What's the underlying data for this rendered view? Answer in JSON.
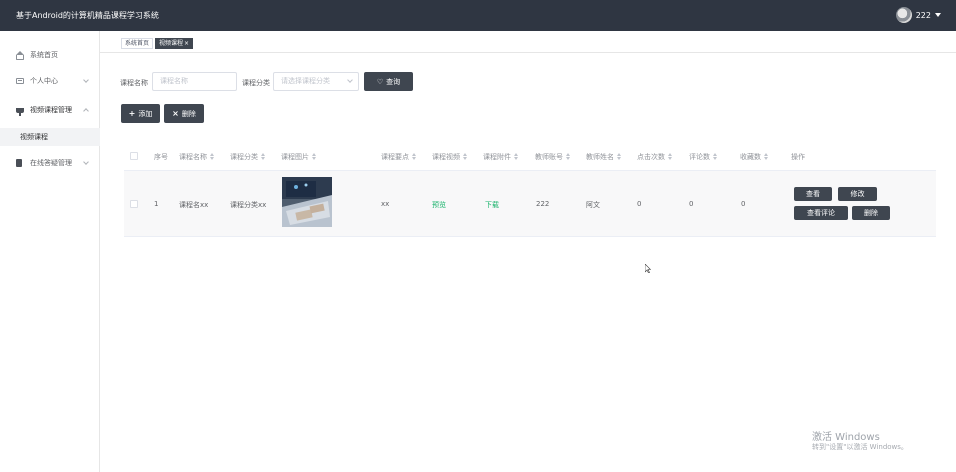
{
  "app": {
    "title": "基于Android的计算机精品课程学习系统"
  },
  "user": {
    "name": "222"
  },
  "sidebar": {
    "items": [
      {
        "label": "系统首页"
      },
      {
        "label": "个人中心"
      },
      {
        "label": "视频课程管理"
      },
      {
        "label": "在线答疑管理"
      }
    ],
    "sub_items": [
      {
        "label": "视频课程"
      }
    ]
  },
  "tabs": [
    {
      "label": "系统首页"
    },
    {
      "label": "视频课程",
      "close": "×"
    }
  ],
  "filters": {
    "course_name_label": "课程名称",
    "course_name_placeholder": "课程名称",
    "category_label": "课程分类",
    "category_placeholder": "请选择课程分类",
    "search_label": "查询"
  },
  "toolbar": {
    "add_label": "添加",
    "delete_label": "删除"
  },
  "table": {
    "columns": [
      "序号",
      "课程名称",
      "课程分类",
      "课程图片",
      "课程要点",
      "课程视频",
      "课程附件",
      "教师账号",
      "教师姓名",
      "点击次数",
      "评论数",
      "收藏数",
      "操作"
    ],
    "rows": [
      {
        "index": "1",
        "course_name": "课程名xx",
        "category": "课程分类xx",
        "key_points": "xx",
        "video": "预览",
        "attachment": "下载",
        "teacher_account": "222",
        "teacher_name": "阿文",
        "clicks": "0",
        "comments": "0",
        "favorites": "0",
        "actions": {
          "view": "查看",
          "edit": "修改",
          "view_comments": "查看评论",
          "delete": "删除"
        }
      }
    ]
  },
  "watermark": {
    "line1": "激活 Windows",
    "line2": "转到\"设置\"以激活 Windows。"
  },
  "colors": {
    "header_bg": "#2f3642",
    "button_bg": "#3f4650",
    "link_green": "#17b26a"
  },
  "icons": [
    "home-icon",
    "user-card-icon",
    "cup-icon",
    "document-icon",
    "chevron-down-icon",
    "chevron-up-icon",
    "heart-icon",
    "plus-icon",
    "close-icon",
    "sort-icon",
    "caret-down-icon"
  ]
}
